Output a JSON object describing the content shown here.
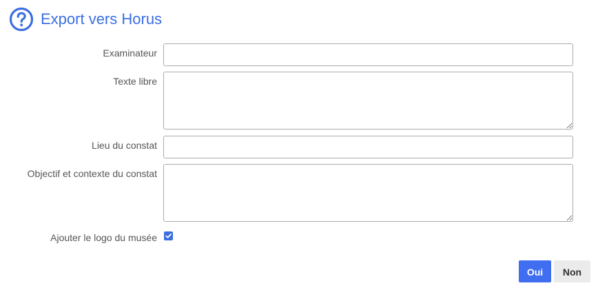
{
  "dialog": {
    "title": "Export vers Horus",
    "icon": "help-circle-icon",
    "accent_color": "#3b6fe0"
  },
  "form": {
    "examinateur": {
      "label": "Examinateur",
      "value": ""
    },
    "texte_libre": {
      "label": "Texte libre",
      "value": ""
    },
    "lieu_du_constat": {
      "label": "Lieu du constat",
      "value": ""
    },
    "objectif_contexte": {
      "label": "Objectif et contexte du constat",
      "value": ""
    },
    "ajouter_logo": {
      "label": "Ajouter le logo du musée",
      "checked": true
    }
  },
  "buttons": {
    "confirm_label": "Oui",
    "cancel_label": "Non",
    "confirm_color": "#3f6ef0",
    "cancel_color": "#ebebeb"
  }
}
